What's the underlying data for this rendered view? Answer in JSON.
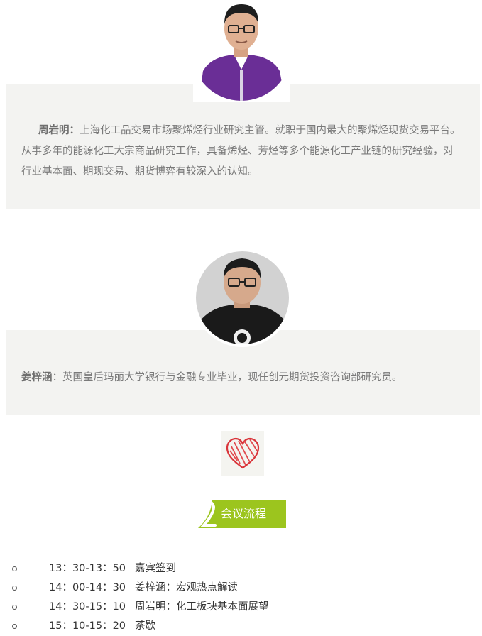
{
  "speakers": [
    {
      "name": "周岩明：",
      "bio": "上海化工品交易市场聚烯烃行业研究主管。就职于国内最大的聚烯烃现货交易平台。从事多年的能源化工大宗商品研究工作，具备烯烃、芳烃等多个能源化工产业链的研究经验，对行业基本面、期现交易、期货博弈有较深入的认知。"
    },
    {
      "name": "姜梓涵",
      "bio": "：英国皇后玛丽大学银行与金融专业毕业，现任创元期货投资咨询部研究员。"
    }
  ],
  "section": {
    "badge_label": "会议流程",
    "badge_color": "#9cc51e"
  },
  "agenda": [
    {
      "time": "13：30-13：50",
      "title": "嘉宾签到"
    },
    {
      "time": "14：00-14：30",
      "title": "姜梓涵：宏观热点解读"
    },
    {
      "time": "14：30-15：10",
      "title": "周岩明：化工板块基本面展望"
    },
    {
      "time": "15：10-15：20",
      "title": "茶歇"
    }
  ]
}
